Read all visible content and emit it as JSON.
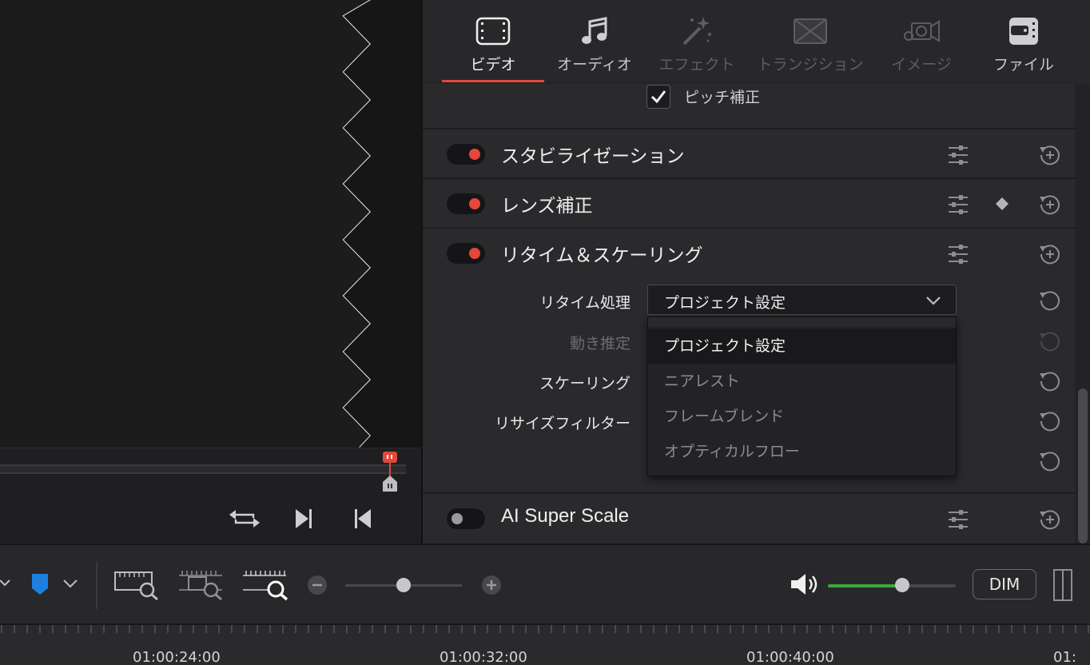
{
  "colors": {
    "accent": "#e4473b",
    "volume_green": "#3ea83a",
    "marker_blue": "#1e7fe0",
    "background": "#28282b"
  },
  "inspector": {
    "tabs": [
      {
        "label": "ビデオ",
        "icon": "film-strip-icon",
        "state": "active"
      },
      {
        "label": "オーディオ",
        "icon": "music-note-icon",
        "state": "enabled"
      },
      {
        "label": "エフェクト",
        "icon": "magic-wand-icon",
        "state": "disabled"
      },
      {
        "label": "トランジション",
        "icon": "transition-icon",
        "state": "disabled"
      },
      {
        "label": "イメージ",
        "icon": "camera-icon",
        "state": "disabled"
      },
      {
        "label": "ファイル",
        "icon": "file-tag-icon",
        "state": "enabled"
      }
    ],
    "pitch_correction": {
      "label": "ピッチ補正",
      "checked": true
    },
    "sections": {
      "stabilization": {
        "title": "スタビライゼーション",
        "enabled": true
      },
      "lens_correction": {
        "title": "レンズ補正",
        "enabled": true
      },
      "retime_scaling": {
        "title": "リタイム＆スケーリング",
        "enabled": true
      },
      "ai_super_scale": {
        "title": "AI Super Scale",
        "enabled": false
      }
    },
    "retime": {
      "process_label": "リタイム処理",
      "process_value": "プロジェクト設定",
      "motion_estimation_label": "動き推定",
      "scaling_label": "スケーリング",
      "resize_filter_label": "リサイズフィルター",
      "options": [
        "プロジェクト設定",
        "ニアレスト",
        "フレームブレンド",
        "オプティカルフロー"
      ]
    }
  },
  "toolbar": {
    "dim_label": "DIM",
    "zoom_level": 0.5,
    "volume_level": 0.58
  },
  "timeline": {
    "timecodes": [
      "01:00:24:00",
      "01:00:32:00",
      "01:00:40:00",
      "01:"
    ]
  }
}
